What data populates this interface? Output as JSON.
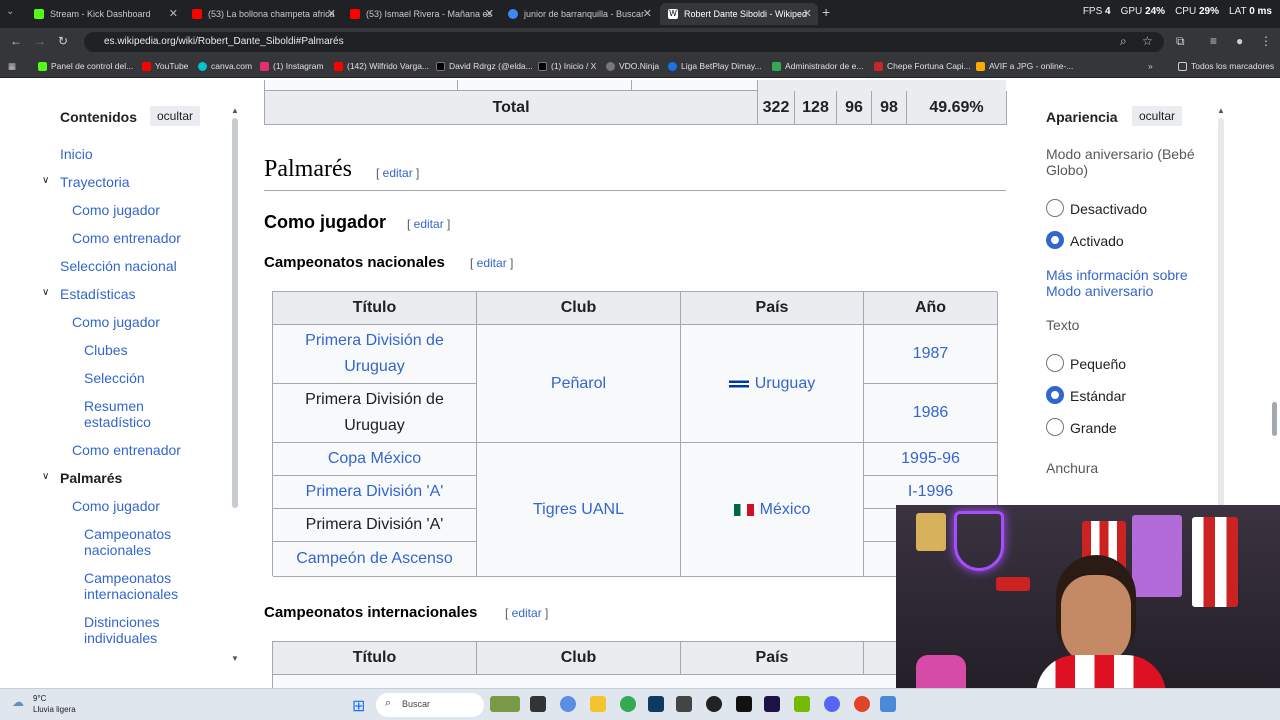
{
  "browser": {
    "tabs": [
      {
        "title": "Stream - Kick Dashboard",
        "color": "#53fc18"
      },
      {
        "title": "(53) La bollona champeta africa",
        "color": "#ff0000"
      },
      {
        "title": "(53) Ismael Rivera - Mañana es",
        "color": "#ff0000"
      },
      {
        "title": "junior de barranquilla - Buscar",
        "color": "#4285f4"
      },
      {
        "title": "Robert Dante Siboldi - Wikiped",
        "color": "#ffffff"
      }
    ],
    "stats": {
      "fps_label": "FPS",
      "fps": "4",
      "gpu_label": "GPU",
      "gpu": "24%",
      "cpu_label": "CPU",
      "cpu": "29%",
      "lat_label": "LAT",
      "lat": "0 ms"
    },
    "url": "es.wikipedia.org/wiki/Robert_Dante_Siboldi#Palmarés",
    "bookmarks": [
      {
        "label": "Panel de control del...",
        "color": "#53fc18"
      },
      {
        "label": "YouTube",
        "color": "#ff0000"
      },
      {
        "label": "canva.com",
        "color": "#00c4cc"
      },
      {
        "label": "(1) Instagram",
        "color": "#e1306c"
      },
      {
        "label": "(142) Wilfrido Varga...",
        "color": "#ff0000"
      },
      {
        "label": "David Rdrgz (@elda...",
        "color": "#000000"
      },
      {
        "label": "(1) Inicio / X",
        "color": "#000000"
      },
      {
        "label": "VDO.Ninja",
        "color": "#444444"
      },
      {
        "label": "Liga BetPlay Dimay...",
        "color": "#1a73e8"
      },
      {
        "label": "Administrador de e...",
        "color": "#34a853"
      },
      {
        "label": "Chepe Fortuna Capi...",
        "color": "#c62828"
      },
      {
        "label": "AVIF a JPG - online-...",
        "color": "#f9ab00"
      }
    ],
    "all_bookmarks": "Todos los marcadores"
  },
  "toc": {
    "title": "Contenidos",
    "hide": "ocultar",
    "items": [
      {
        "label": "Inicio"
      },
      {
        "label": "Trayectoria"
      },
      {
        "label": "Como jugador"
      },
      {
        "label": "Como entrenador"
      },
      {
        "label": "Selección nacional"
      },
      {
        "label": "Estadísticas"
      },
      {
        "label": "Como jugador"
      },
      {
        "label": "Clubes"
      },
      {
        "label": "Selección"
      },
      {
        "label": "Resumen estadístico"
      },
      {
        "label": "Como entrenador"
      },
      {
        "label": "Palmarés"
      },
      {
        "label": "Como jugador"
      },
      {
        "label": "Campeonatos nacionales"
      },
      {
        "label": "Campeonatos internacionales"
      },
      {
        "label": "Distinciones individuales"
      }
    ]
  },
  "content": {
    "total_row": {
      "label": "Total",
      "v1": "322",
      "v2": "128",
      "v3": "96",
      "v4": "98",
      "pct": "49.69%"
    },
    "h2": "Palmarés",
    "edit": "editar",
    "h3": "Como jugador",
    "h4_nac": "Campeonatos nacionales",
    "h4_int": "Campeonatos internacionales",
    "headers": {
      "titulo": "Título",
      "club": "Club",
      "pais": "País",
      "anio": "Año"
    },
    "rows": [
      {
        "titulo": "Primera División de Uruguay",
        "anio": "1987"
      },
      {
        "titulo": "Primera División de Uruguay",
        "anio": "1986"
      },
      {
        "titulo": "Copa México",
        "anio": "1995-96"
      },
      {
        "titulo": "Primera División 'A'",
        "anio": "I-1996"
      },
      {
        "titulo": "Primera División 'A'",
        "anio": ""
      },
      {
        "titulo": "Campeón de Ascenso",
        "anio": ""
      }
    ],
    "club_penarol": "Peñarol",
    "pais_uruguay": "Uruguay",
    "club_tigres": "Tigres UANL",
    "pais_mexico": "México"
  },
  "appearance": {
    "title": "Apariencia",
    "hide": "ocultar",
    "anniversary_label": "Modo aniversario (Bebé Globo)",
    "off": "Desactivado",
    "on": "Activado",
    "more_info": "Más información sobre Modo aniversario",
    "text_label": "Texto",
    "small": "Pequeño",
    "standard": "Estándar",
    "large": "Grande",
    "width_label": "Anchura"
  },
  "taskbar": {
    "temp": "9°C",
    "weather": "Lluvia ligera",
    "search": "Buscar"
  }
}
